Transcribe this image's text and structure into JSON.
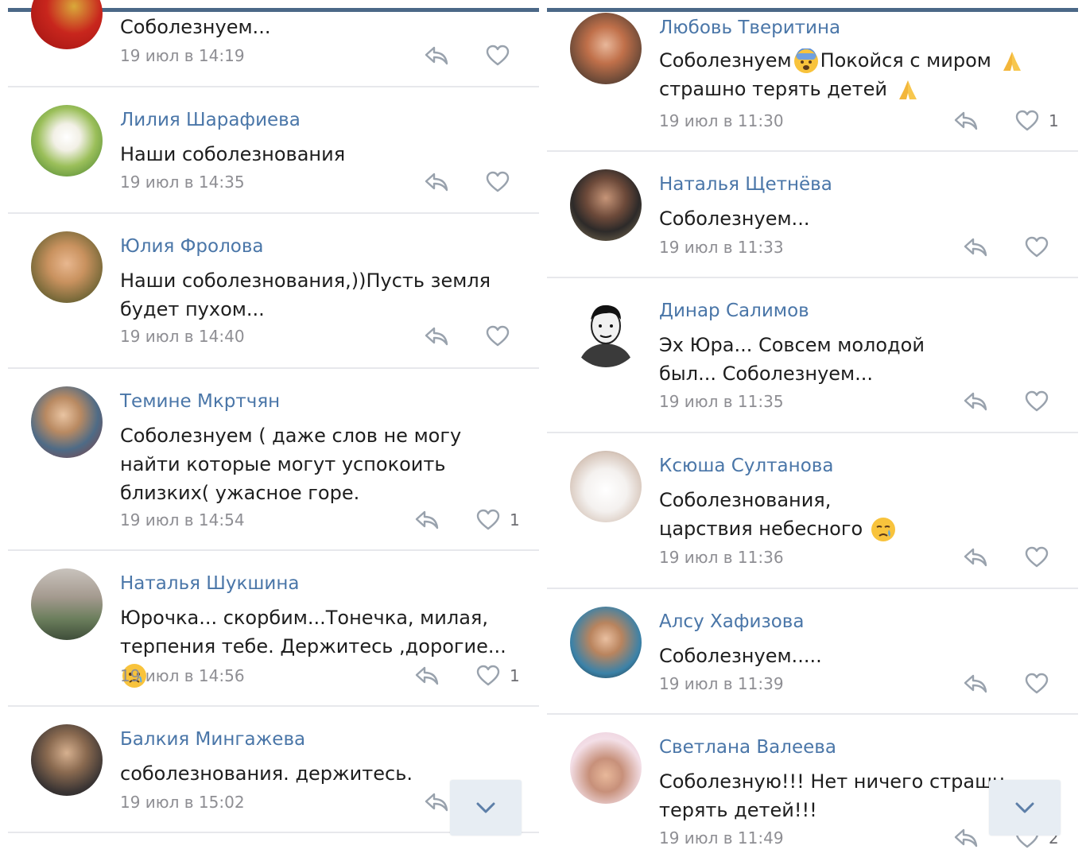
{
  "colors": {
    "accent": "#4a76a8",
    "topbar": "#4b6887",
    "text": "#1e1e1e",
    "meta": "#8e8e93"
  },
  "left": {
    "comments": [
      {
        "author": "",
        "text": "Соболезнуем...",
        "date": "19 июл в 14:19",
        "likes": ""
      },
      {
        "author": "Лилия Шарафиева",
        "text": "Наши соболезнования",
        "date": "19 июл в 14:35",
        "likes": ""
      },
      {
        "author": "Юлия Фролова",
        "text": "Наши соболезнования,))Пусть земля будет пухом...",
        "date": "19 июл в 14:40",
        "likes": ""
      },
      {
        "author": "Темине Мкртчян",
        "text": "Соболезнуем ( даже слов не могу найти которые могут успокоить близких( ужасное горе.",
        "date": "19 июл в 14:54",
        "likes": "1"
      },
      {
        "author": "Наталья Шукшина",
        "text": "Юрочка... скорбим...Тонечка, милая, терпения тебе. Держитесь ,дорогие...",
        "date": "19 июл в 14:56",
        "likes": "1"
      },
      {
        "author": "Балкия Мингажева",
        "text": "соболезнования. держитесь.",
        "date": "19 июл в 15:02",
        "likes": ""
      }
    ]
  },
  "right": {
    "comments": [
      {
        "author": "Любовь Тверитина",
        "text": "Соболезнуем",
        "text2": "Покойся с миром",
        "text3": "страшно терять детей",
        "date": "19 июл в 11:30",
        "likes": "1"
      },
      {
        "author": "Наталья Щетнёва",
        "text": "Соболезнуем...",
        "date": "19 июл в 11:33",
        "likes": ""
      },
      {
        "author": "Динар Салимов",
        "text": "Эх Юра... Совсем молодой был... Соболезнуем...",
        "date": "19 июл в 11:35",
        "likes": ""
      },
      {
        "author": "Ксюша Султанова",
        "text": "Соболезнования, царствия небесного",
        "date": "19 июл в 11:36",
        "likes": ""
      },
      {
        "author": "Алсу Хафизова",
        "text": "Соболезнуем.....",
        "date": "19 июл в 11:39",
        "likes": ""
      },
      {
        "author": "Светлана Валеева",
        "text": "Соболезную!!! Нет ничего страшн",
        "text2": "терять детей!!!",
        "date": "19 июл в 11:49",
        "likes": "2"
      }
    ]
  }
}
